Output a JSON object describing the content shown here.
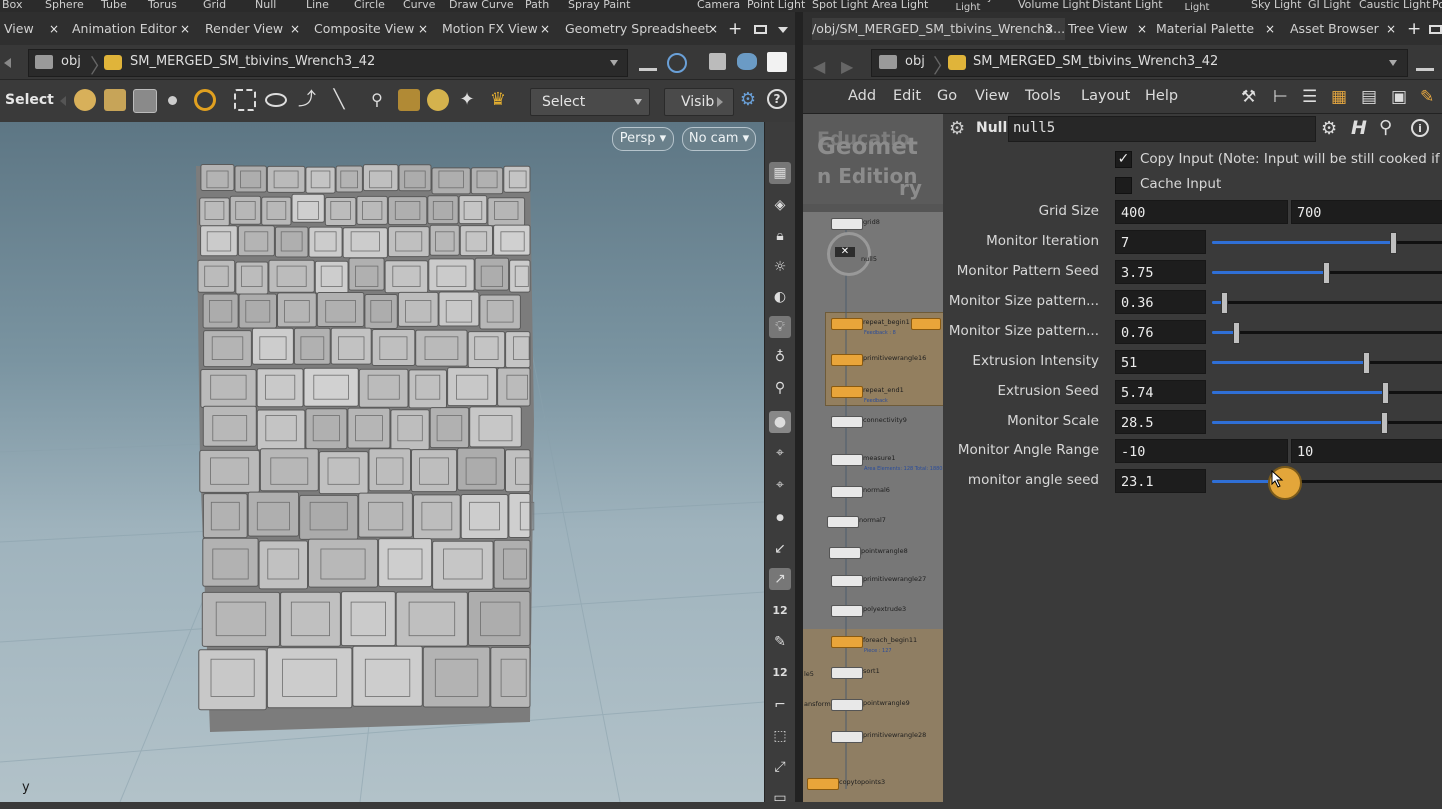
{
  "shelf": {
    "items": [
      "Box",
      "Sphere",
      "Tube",
      "Torus",
      "Grid",
      "Null",
      "Line",
      "Circle",
      "Curve",
      "Draw Curve",
      "Path",
      "Spray Paint",
      "Camera",
      "Point Light",
      "Spot Light",
      "Area Light",
      "Geometry Light",
      "Volume Light",
      "Distant Light",
      "Environment Light",
      "Sky Light",
      "GI Light",
      "Caustic Light",
      "Po"
    ]
  },
  "left_tabs": [
    {
      "label": "View"
    },
    {
      "label": "Animation Editor"
    },
    {
      "label": "Render View"
    },
    {
      "label": "Composite View"
    },
    {
      "label": "Motion FX View"
    },
    {
      "label": "Geometry Spreadsheet"
    }
  ],
  "right_tabs": [
    {
      "label": "/obj/SM_MERGED_SM_tbivins_Wrench3..."
    },
    {
      "label": "Tree View"
    },
    {
      "label": "Material Palette"
    },
    {
      "label": "Asset Browser"
    }
  ],
  "tab_close": "×",
  "tab_add": "+",
  "left_path": {
    "root": "obj",
    "node": "SM_MERGED_SM_tbivins_Wrench3_42"
  },
  "right_path": {
    "root": "obj",
    "node": "SM_MERGED_SM_tbivins_Wrench3_42"
  },
  "viewport_toolbar": {
    "mode_label": "Select",
    "select_dropdown": "Select",
    "visibility_label": "Visib"
  },
  "viewport": {
    "camera_button": "Persp",
    "nocam_button": "No cam",
    "axis_label": "y"
  },
  "network_menu": [
    "Add",
    "Edit",
    "Go",
    "View",
    "Tools",
    "Layout",
    "Help"
  ],
  "network_watermark": {
    "line1": "Educatio",
    "line2": "Geomet",
    "line3": "n Edition",
    "line4": "ry"
  },
  "nodes": [
    {
      "name": "grid8",
      "sub": ""
    },
    {
      "name": "null5",
      "sub": ""
    },
    {
      "name": "repeat_begin1",
      "sub": "Feedback : 8"
    },
    {
      "name": "primitivewrangle16",
      "sub": ""
    },
    {
      "name": "repeat_end1",
      "sub": "Feedback"
    },
    {
      "name": "connectivity9",
      "sub": ""
    },
    {
      "name": "measure1",
      "sub": "Area Elements: 128 Total: 1880.00000"
    },
    {
      "name": "normal6",
      "sub": ""
    },
    {
      "name": "normal7",
      "sub": ""
    },
    {
      "name": "pointwrangle8",
      "sub": ""
    },
    {
      "name": "primitivewrangle27",
      "sub": ""
    },
    {
      "name": "polyextrude3",
      "sub": ""
    },
    {
      "name": "foreach_begin11",
      "sub": "Piece : 127"
    },
    {
      "name": "sort1",
      "sub": ""
    },
    {
      "name": "pointwrangle9",
      "sub": ""
    },
    {
      "name": "primitivewrangle28",
      "sub": ""
    },
    {
      "name": "copytopoints3",
      "sub": ""
    }
  ],
  "net_side_labels": {
    "a": "le5",
    "b": "ansform"
  },
  "params": {
    "node_type": "Null",
    "node_name": "null5",
    "copy_input_label": "Copy Input (Note: Input will be still cooked if disa",
    "cache_input_label": "Cache Input",
    "check_mark": "✓",
    "rows": [
      {
        "label": "Grid Size",
        "value": "400",
        "value2": "700"
      },
      {
        "label": "Monitor Iteration",
        "value": "7",
        "slider": 0.6
      },
      {
        "label": "Monitor Pattern Seed",
        "value": "3.75",
        "slider": 0.375
      },
      {
        "label": "Monitor Size pattern...",
        "value": "0.36",
        "slider": 0.036
      },
      {
        "label": "Monitor Size pattern...",
        "value": "0.76",
        "slider": 0.076
      },
      {
        "label": "Extrusion Intensity",
        "value": "51",
        "slider": 0.51
      },
      {
        "label": "Extrusion Seed",
        "value": "5.74",
        "slider": 0.574
      },
      {
        "label": "Monitor Scale",
        "value": "28.5",
        "slider": 0.57
      },
      {
        "label": "Monitor Angle Range",
        "value": "-10",
        "value2": "10"
      },
      {
        "label": "monitor angle seed",
        "value": "23.1",
        "slider": 0.231
      }
    ]
  },
  "colors": {
    "accent": "#2f6fd6",
    "node_orange": "#e9a53a",
    "bg": "#3a3a3a"
  }
}
